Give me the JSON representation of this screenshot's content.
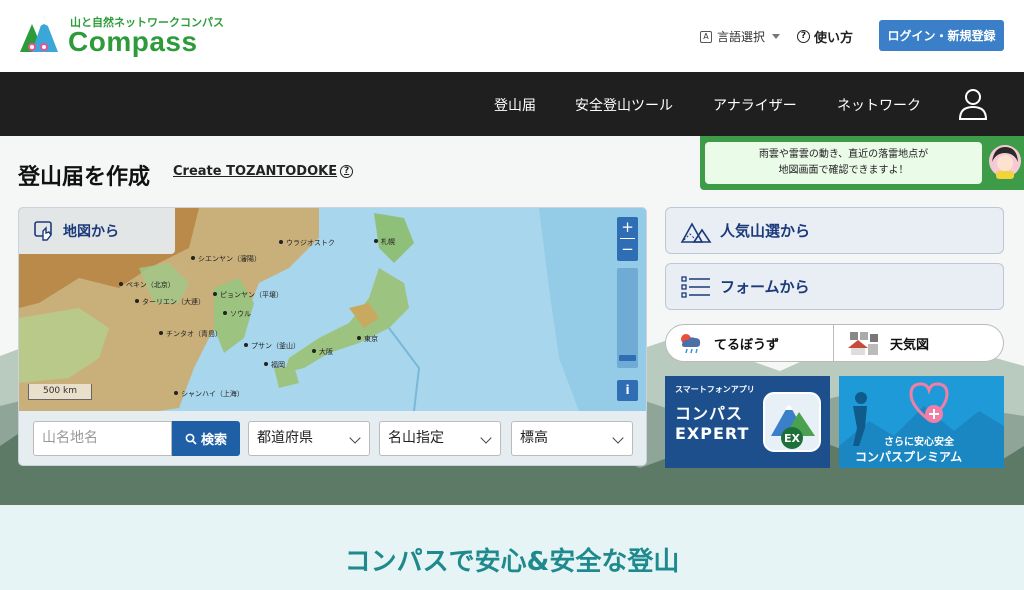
{
  "header": {
    "logo_tagline": "山と自然ネットワークコンパス",
    "logo_name": "Compass",
    "language_label": "言語選択",
    "language_box": "A",
    "howto_label": "使い方",
    "login_label": "ログイン・新規登録"
  },
  "nav": {
    "items": [
      "登山届",
      "安全登山ツール",
      "アナライザー",
      "ネットワーク"
    ]
  },
  "notice": {
    "line1": "雨雲や雷雲の動き、直近の落雷地点が",
    "line2": "地図画面で確認できますよ！"
  },
  "main": {
    "title": "登山届を作成",
    "create_link": "Create TOZANTODOKE"
  },
  "map": {
    "tab_label": "地図から",
    "zoom_in": "+",
    "zoom_out": "−",
    "info": "i",
    "scale": "500 km",
    "places": [
      "ウラジオストク",
      "札幌",
      "シエンヤン（瀋陽）",
      "ペキン（北京）",
      "ターリエン（大連）",
      "ピョンヤン（平壌）",
      "ソウル",
      "チンタオ（青島）",
      "プサン（釜山）",
      "大阪",
      "東京",
      "福岡",
      "シャンハイ（上海）"
    ]
  },
  "search": {
    "placeholder": "山名地名",
    "button": "検索",
    "prefecture": "都道府県",
    "mountain": "名山指定",
    "altitude": "標高"
  },
  "side": {
    "popular": "人気山選から",
    "form": "フォームから",
    "terubo": "てるぼうず",
    "weather": "天気図"
  },
  "banners": {
    "expert_small": "スマートフォンアプリ",
    "expert_line1": "コンパス",
    "expert_line2": "EXPERT",
    "expert_badge": "EX",
    "premium_line1": "さらに安心安全",
    "premium_line2": "コンパスプレミアム"
  },
  "bottom": {
    "headline": "コンパスで安心&安全な登山"
  },
  "colors": {
    "brand_green": "#2e9b3a",
    "accent_blue": "#3a7fc8",
    "nav_dark": "#1f1f1f",
    "teal_headline": "#1f8a8d"
  }
}
